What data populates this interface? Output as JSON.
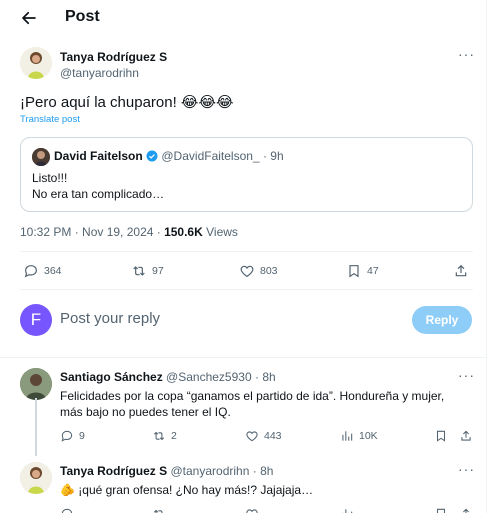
{
  "header": {
    "title": "Post"
  },
  "main_post": {
    "author_name": "Tanya Rodríguez S",
    "author_handle": "@tanyarodrihn",
    "text": "¡Pero aquí la chuparon! 😂😂😂",
    "translate": "Translate post",
    "quote": {
      "author_name": "David Faitelson",
      "author_handle": "@DavidFaitelson_",
      "time": "9h",
      "lines": [
        "Listo!!!",
        "No era tan complicado…"
      ]
    },
    "time": "10:32 PM · Nov 19, 2024 · ",
    "views_count": "150.6K",
    "views_label": " Views",
    "stats": {
      "replies": "364",
      "reposts": "97",
      "likes": "803",
      "bookmarks": "47"
    }
  },
  "composer": {
    "avatar_letter": "F",
    "placeholder": "Post your reply",
    "button": "Reply",
    "avatar_color": "#7856ff"
  },
  "replies": [
    {
      "author_name": "Santiago Sánchez",
      "author_handle": "@Sanchez5930",
      "time": "8h",
      "text_1": "Felicidades por la copa “ganamos el partido de ida”. Hondureña y mujer,",
      "text_2": "más bajo no puedes tener el IQ.",
      "stats": {
        "replies": "9",
        "reposts": "2",
        "likes": "443",
        "views": "10K"
      }
    },
    {
      "author_name": "Tanya Rodríguez S",
      "author_handle": "@tanyarodrihn",
      "time": "8h",
      "text_1": "🫵 ¡qué gran ofensa! ¿No hay más!? Jajajaja…"
    }
  ],
  "colors": {
    "accent": "#1d9bf0",
    "reply_button": "#8ecdf7",
    "muted": "#536471"
  }
}
